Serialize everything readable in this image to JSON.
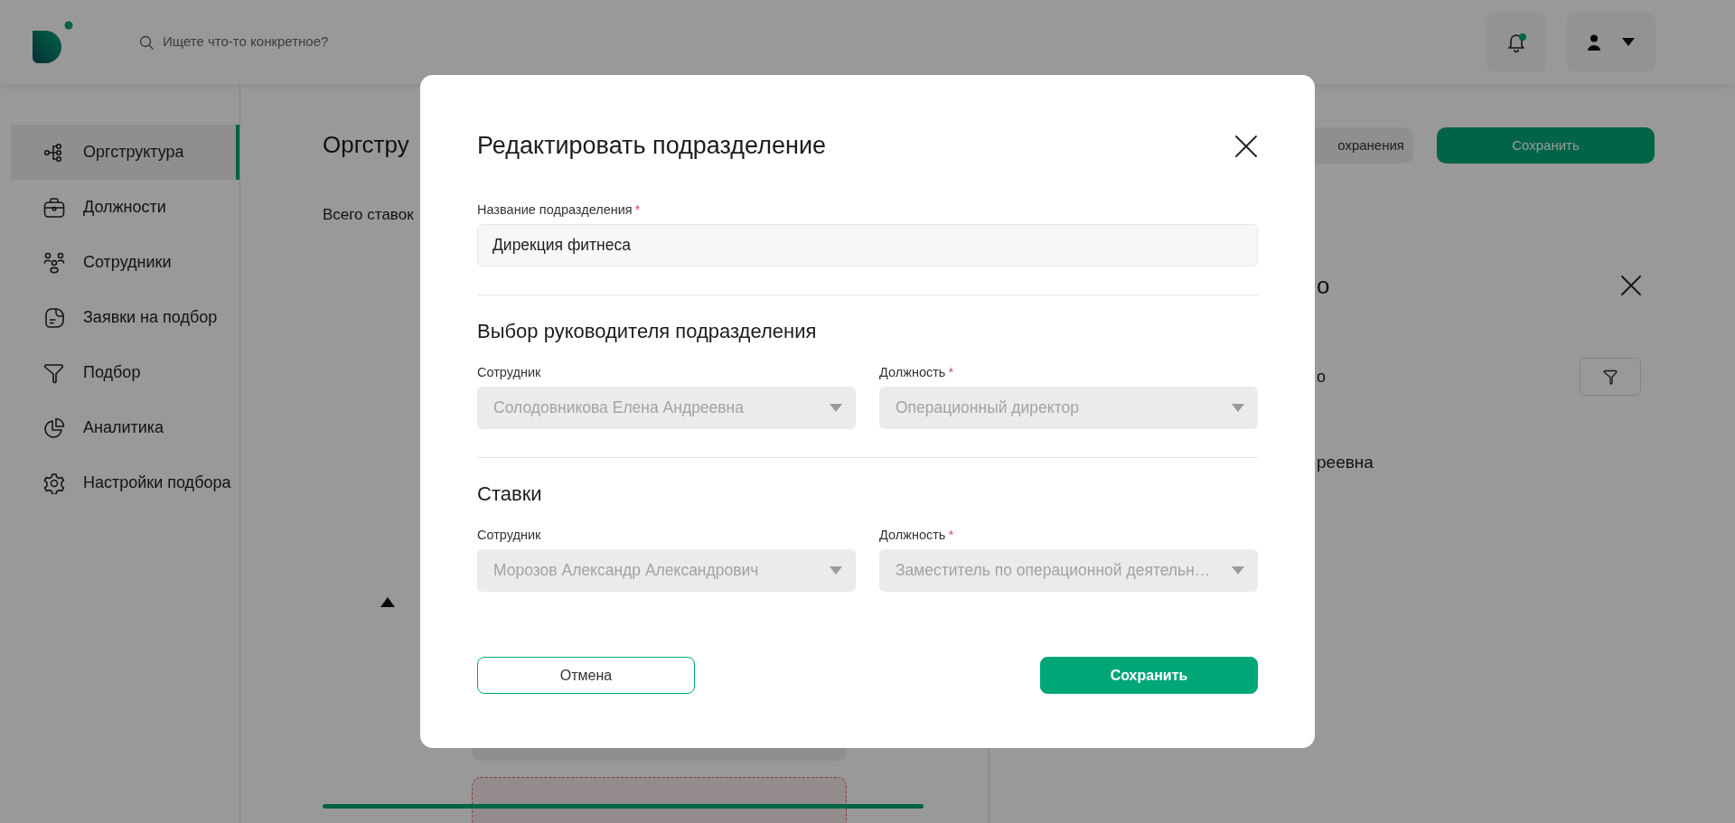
{
  "header": {
    "search": {
      "placeholder": "Ищете что-то конкретное?"
    },
    "notifications": {
      "unread": true
    }
  },
  "sidebar": {
    "items": [
      {
        "label": "Оргструктура",
        "selected": true
      },
      {
        "label": "Должности",
        "selected": false
      },
      {
        "label": "Сотрудники",
        "selected": false
      },
      {
        "label": "Заявки на подбор",
        "selected": false
      },
      {
        "label": "Подбор",
        "selected": false
      },
      {
        "label": "Аналитика",
        "selected": false
      },
      {
        "label": "Настройки подбора",
        "selected": false
      }
    ]
  },
  "page": {
    "title": "Оргстру",
    "summary": "Всего ставок",
    "buttons": [
      {
        "label": "охранения",
        "kind": "secondary"
      },
      {
        "label": "Сохранить",
        "kind": "primary"
      }
    ]
  },
  "side_panel": {
    "title": "о",
    "subtitle": "о",
    "person": "реевна"
  },
  "modal": {
    "title": "Редактировать подразделение",
    "name_field": {
      "label": "Название подразделения",
      "required_mark": "*",
      "value": "Дирекция фитнеса"
    },
    "sections": [
      {
        "title": "Выбор руководителя подразделения",
        "fields": [
          {
            "label": "Сотрудник",
            "value": "Солодовникова Елена Андреевна",
            "disabled": true
          },
          {
            "label": "Должность",
            "required_mark": "*",
            "value": "Операционный директор",
            "disabled": true
          }
        ]
      },
      {
        "title": "Ставки",
        "fields": [
          {
            "label": "Сотрудник",
            "value": "Морозов Александр Александрович",
            "disabled": true
          },
          {
            "label": "Должность",
            "required_mark": "*",
            "value": "Заместитель по операционной деятельн…",
            "disabled": true
          }
        ]
      }
    ],
    "buttons": [
      {
        "label": "Отмена",
        "kind": "outline"
      },
      {
        "label": "Сохранить",
        "kind": "primary"
      }
    ]
  }
}
